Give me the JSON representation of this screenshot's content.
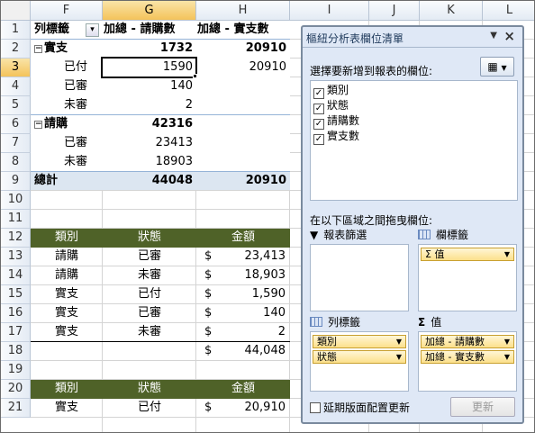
{
  "columns": [
    "F",
    "G",
    "H",
    "I",
    "J",
    "K",
    "L"
  ],
  "rows": [
    "1",
    "2",
    "3",
    "4",
    "5",
    "6",
    "7",
    "8",
    "9",
    "10",
    "11",
    "12",
    "13",
    "14",
    "15",
    "16",
    "17",
    "18",
    "19",
    "20",
    "21"
  ],
  "pivot": {
    "header": {
      "row_labels": "列標籤",
      "col_g": "加總 - 請購數",
      "col_h": "加總 - 實支數"
    },
    "rows": [
      {
        "label": "實支",
        "g": "1732",
        "h": "20910",
        "group": true
      },
      {
        "label": "已付",
        "g": "1590",
        "h": "20910"
      },
      {
        "label": "已審",
        "g": "140",
        "h": ""
      },
      {
        "label": "未審",
        "g": "2",
        "h": ""
      },
      {
        "label": "請購",
        "g": "42316",
        "h": "",
        "group": true
      },
      {
        "label": "已審",
        "g": "23413",
        "h": ""
      },
      {
        "label": "未審",
        "g": "18903",
        "h": ""
      }
    ],
    "total": {
      "label": "總計",
      "g": "44048",
      "h": "20910"
    }
  },
  "table1": {
    "headers": [
      "類別",
      "狀態",
      "金額"
    ],
    "rows": [
      {
        "cat": "請購",
        "status": "已審",
        "cur": "$",
        "amt": "23,413"
      },
      {
        "cat": "請購",
        "status": "未審",
        "cur": "$",
        "amt": "18,903"
      },
      {
        "cat": "實支",
        "status": "已付",
        "cur": "$",
        "amt": "1,590"
      },
      {
        "cat": "實支",
        "status": "已審",
        "cur": "$",
        "amt": "140"
      },
      {
        "cat": "實支",
        "status": "未審",
        "cur": "$",
        "amt": "2"
      }
    ],
    "sum_cur": "$",
    "sum": "44,048"
  },
  "table2": {
    "headers": [
      "類別",
      "狀態",
      "金額"
    ],
    "rows": [
      {
        "cat": "實支",
        "status": "已付",
        "cur": "$",
        "amt": "20,910"
      }
    ]
  },
  "pane": {
    "title": "樞紐分析表欄位清單",
    "choose_label": "選擇要新增到報表的欄位:",
    "fields": [
      "類別",
      "狀態",
      "請購數",
      "實支數"
    ],
    "drag_label": "在以下區域之間拖曳欄位:",
    "zones": {
      "filter": "報表篩選",
      "columns": "欄標籤",
      "rows": "列標籤",
      "values": "值"
    },
    "column_chips": [
      "Σ 值"
    ],
    "row_chips": [
      "類別",
      "狀態"
    ],
    "value_chips": [
      "加總 - 請購數",
      "加總 - 實支數"
    ],
    "defer_label": "延期版面配置更新",
    "update_label": "更新"
  }
}
